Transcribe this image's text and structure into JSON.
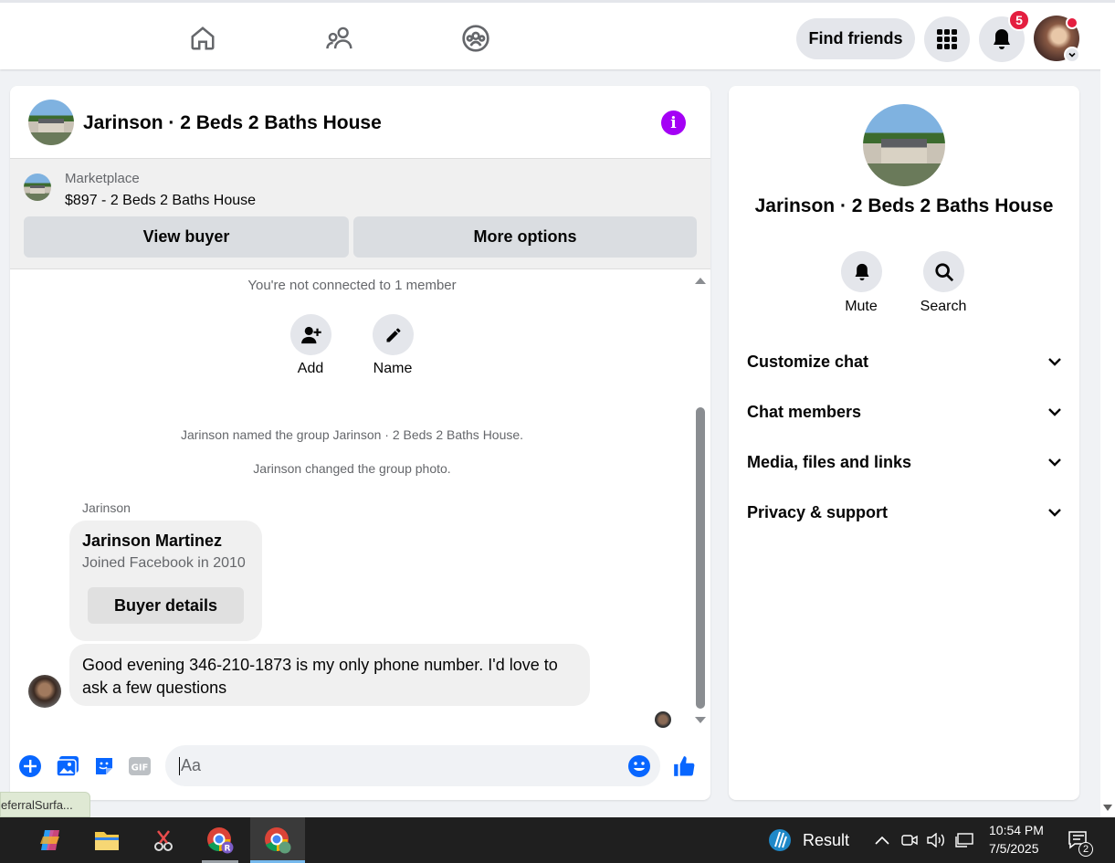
{
  "topnav": {
    "find_friends": "Find friends",
    "notifications_count": "5",
    "icons": [
      "home-icon",
      "friends-icon",
      "groups-icon",
      "apps-grid-icon",
      "bell-icon"
    ]
  },
  "chat": {
    "title": "Jarinson · 2 Beds 2 Baths House",
    "marketplace": {
      "label": "Marketplace",
      "listing": "$897 - 2 Beds 2 Baths House",
      "view_buyer": "View buyer",
      "more_options": "More options"
    },
    "not_connected": "You're not connected to 1 member",
    "actions": [
      {
        "label": "Add",
        "icon": "add-person-icon"
      },
      {
        "label": "Name",
        "icon": "pencil-icon"
      }
    ],
    "events": [
      "Jarinson named the group Jarinson · 2 Beds 2 Baths House.",
      "Jarinson changed the group photo."
    ],
    "sender": "Jarinson",
    "buyer_card": {
      "name": "Jarinson Martinez",
      "joined": "Joined Facebook in 2010",
      "button": "Buyer details"
    },
    "message": "Good evening 346-210-1873 is my only phone number. I'd love to ask a few questions",
    "composer_placeholder": "Aa"
  },
  "info_panel": {
    "title": "Jarinson · 2 Beds 2 Baths House",
    "actions": [
      {
        "label": "Mute",
        "icon": "bell-icon"
      },
      {
        "label": "Search",
        "icon": "search-icon"
      }
    ],
    "sections": [
      "Customize chat",
      "Chat members",
      "Media, files and links",
      "Privacy & support"
    ]
  },
  "status_link": "eferralSurfa...",
  "taskbar": {
    "weather_label": "Result",
    "time": "10:54 PM",
    "date": "7/5/2025",
    "notification_count": "2"
  },
  "colors": {
    "accent_blue": "#0866ff",
    "info_purple": "#a400f5",
    "badge_red": "#e41e3f"
  }
}
